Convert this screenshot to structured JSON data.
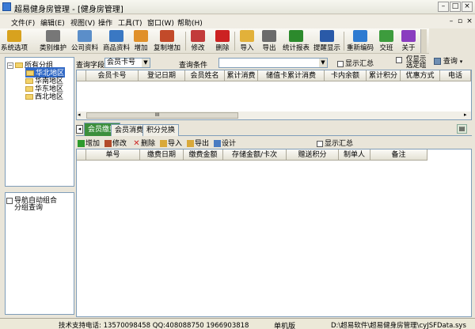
{
  "window": {
    "title": "超易健身房管理 - [健身房管理]"
  },
  "menu": [
    "文件(F)",
    "编辑(E)",
    "视图(V)",
    "操作",
    "工具(T)",
    "窗口(W)",
    "帮助(H)"
  ],
  "toolbar": [
    {
      "label": "系统选项",
      "icon": "key-icon",
      "color": "#d8a21e"
    },
    {
      "label": "类别维护",
      "icon": "tools-icon",
      "color": "#777777"
    },
    {
      "label": "公司资料",
      "icon": "folder-icon",
      "color": "#5b8ec9"
    },
    {
      "label": "商品资料",
      "icon": "box-icon",
      "color": "#3a78c3"
    },
    {
      "label": "增加",
      "icon": "add-user-icon",
      "color": "#e0902a"
    },
    {
      "label": "复制增加",
      "icon": "copy-icon",
      "color": "#c24a2a"
    },
    {
      "label": "修改",
      "icon": "pencil-icon",
      "color": "#c23b3b"
    },
    {
      "label": "删除",
      "icon": "delete-icon",
      "color": "#cc2222"
    },
    {
      "label": "导入",
      "icon": "import-icon",
      "color": "#e2b13a"
    },
    {
      "label": "导出",
      "icon": "printer-icon",
      "color": "#6b6b6b"
    },
    {
      "label": "统计报表",
      "icon": "chart-icon",
      "color": "#2c8a2c"
    },
    {
      "label": "提醒显示",
      "icon": "bell-icon",
      "color": "#2a5aa8"
    },
    {
      "label": "重新编码",
      "icon": "recode-icon",
      "color": "#2e7bd1"
    },
    {
      "label": "交班",
      "icon": "robot-icon",
      "color": "#3d9c3d"
    },
    {
      "label": "关于",
      "icon": "help-icon",
      "color": "#8a3dbf"
    }
  ],
  "tree": {
    "root": "所有分组",
    "children": [
      "华北地区",
      "华南地区",
      "华东地区",
      "西北地区"
    ]
  },
  "nav": {
    "auto_combine_label": "导航自动组合",
    "group_query_label": "分组查询"
  },
  "query": {
    "field_label": "查询字段",
    "field_value": "会员卡号",
    "condition_label": "查询条件",
    "condition_value": "",
    "show_summary": "显示汇总",
    "only_selected_line1": "仅显示",
    "only_selected_line2": "选定组",
    "search_button": "查询"
  },
  "top_grid": {
    "columns": [
      "会员卡号",
      "登记日期",
      "会员姓名",
      "累计消费",
      "储值卡累计消费",
      "卡内余额",
      "累计积分",
      "优惠方式",
      "电话"
    ],
    "scroll_marker": "III"
  },
  "tabs": [
    "会员缴费",
    "会员消费",
    "积分兑换"
  ],
  "sub_toolbar": {
    "add": "增加",
    "edit": "修改",
    "delete": "删除",
    "import": "导入",
    "export": "导出",
    "design": "设计",
    "show_summary": "显示汇总"
  },
  "bottom_grid": {
    "columns": [
      "单号",
      "缴费日期",
      "缴费金额",
      "存储金额/卡次",
      "赠送积分",
      "制单人",
      "备注"
    ]
  },
  "status": {
    "support": "技术支持电话: 13570098458 QQ:408088750 1966903818",
    "mode": "单机版",
    "path": "D:\\超易软件\\超易健身房管理\\cyJSFData.sys"
  }
}
